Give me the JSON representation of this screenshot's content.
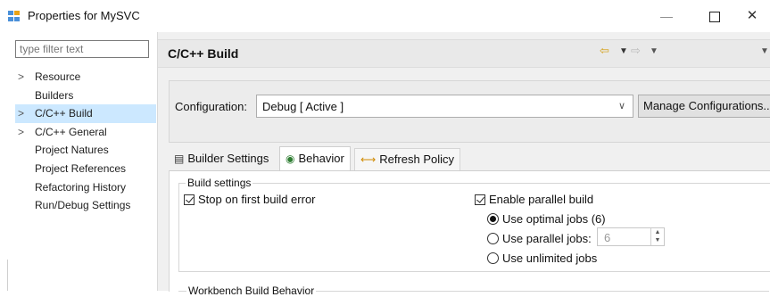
{
  "window": {
    "title": "Properties for MySVC",
    "minimize_glyph": "—",
    "close_glyph": "✕"
  },
  "left": {
    "filter_placeholder": "type filter text",
    "tree": [
      {
        "label": "Resource",
        "expandable": true,
        "selected": false
      },
      {
        "label": "Builders",
        "expandable": false,
        "selected": false
      },
      {
        "label": "C/C++ Build",
        "expandable": true,
        "selected": true
      },
      {
        "label": "C/C++ General",
        "expandable": true,
        "selected": false
      },
      {
        "label": "Project Natures",
        "expandable": false,
        "selected": false
      },
      {
        "label": "Project References",
        "expandable": false,
        "selected": false
      },
      {
        "label": "Refactoring History",
        "expandable": false,
        "selected": false
      },
      {
        "label": "Run/Debug Settings",
        "expandable": false,
        "selected": false
      }
    ]
  },
  "header": {
    "title": "C/C++ Build",
    "back_icon": "back-arrow-icon",
    "forward_icon": "forward-arrow-icon"
  },
  "config": {
    "label": "Configuration:",
    "value": "Debug  [ Active ]",
    "manage_label": "Manage Configurations..."
  },
  "tabs": [
    {
      "label": "Builder Settings",
      "icon": "builder-settings-icon",
      "active": false
    },
    {
      "label": "Behavior",
      "icon": "behavior-icon",
      "active": true
    },
    {
      "label": "Refresh Policy",
      "icon": "refresh-policy-icon",
      "active": false
    }
  ],
  "build_settings": {
    "title": "Build settings",
    "stop_on_error": {
      "label": "Stop on first build error",
      "checked": true
    },
    "parallel": {
      "label": "Enable parallel build",
      "checked": true
    },
    "optimal": {
      "label": "Use optimal jobs (6)",
      "selected": true
    },
    "parallel_jobs": {
      "label": "Use parallel jobs:",
      "selected": false,
      "value": "6"
    },
    "unlimited": {
      "label": "Use unlimited jobs",
      "selected": false
    }
  },
  "workbench": {
    "title": "Workbench Build Behavior"
  },
  "colors": {
    "selection": "#cce8ff",
    "pane_bg": "#f0f0f0",
    "back_arrow": "#d4a017"
  }
}
